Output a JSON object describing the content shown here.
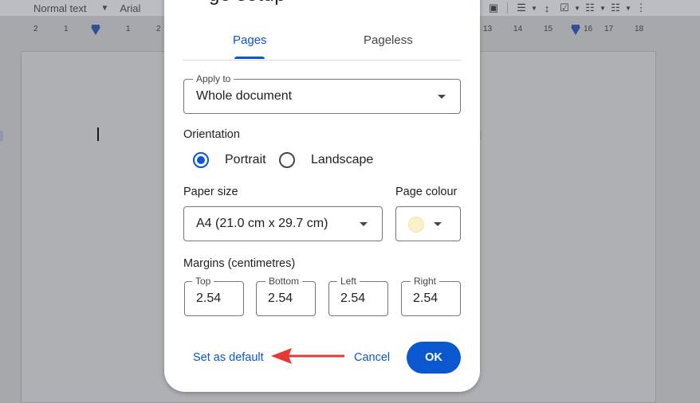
{
  "toolbar": {
    "style_value": "Normal text",
    "font_value": "Arial"
  },
  "ruler": {
    "left_numbers": [
      "2",
      "1",
      "1",
      "2"
    ],
    "right_numbers": [
      "13",
      "14",
      "15",
      "16",
      "17",
      "18"
    ]
  },
  "dialog": {
    "title_fragment": "ge setup",
    "tabs": [
      {
        "label": "Pages",
        "selected": true
      },
      {
        "label": "Pageless",
        "selected": false
      }
    ],
    "apply_to": {
      "label": "Apply to",
      "value": "Whole document"
    },
    "orientation": {
      "label": "Orientation",
      "options": [
        {
          "label": "Portrait",
          "selected": true
        },
        {
          "label": "Landscape",
          "selected": false
        }
      ]
    },
    "paper_size": {
      "label": "Paper size",
      "value": "A4 (21.0 cm x 29.7 cm)"
    },
    "page_colour": {
      "label": "Page colour",
      "color": "#fbf0c8"
    },
    "margins": {
      "label": "Margins (centimetres)",
      "top": {
        "label": "Top",
        "value": "2.54"
      },
      "bottom": {
        "label": "Bottom",
        "value": "2.54"
      },
      "left": {
        "label": "Left",
        "value": "2.54"
      },
      "right": {
        "label": "Right",
        "value": "2.54"
      }
    },
    "actions": {
      "set_default": "Set as default",
      "cancel": "Cancel",
      "ok": "OK"
    }
  },
  "colors": {
    "accent": "#0b57d0",
    "annotation_arrow": "#e53935"
  }
}
